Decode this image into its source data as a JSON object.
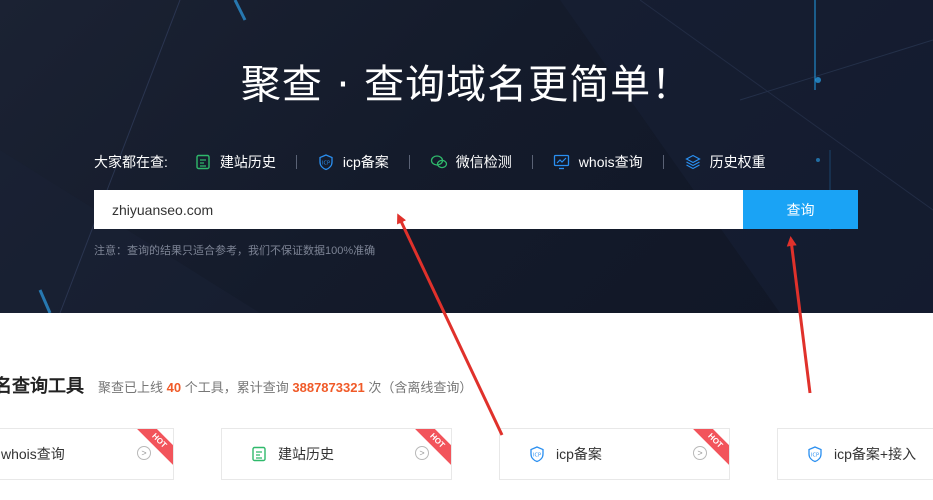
{
  "hero": {
    "title": "聚查 · 查询域名更简单！",
    "trending_label": "大家都在查:",
    "trending": [
      {
        "label": "建站历史",
        "icon": "history-icon",
        "color": "#2fb96b"
      },
      {
        "label": "icp备案",
        "icon": "icp-shield-icon",
        "color": "#2a8ff0"
      },
      {
        "label": "微信检测",
        "icon": "wechat-icon",
        "color": "#2fb96b"
      },
      {
        "label": "whois查询",
        "icon": "whois-monitor-icon",
        "color": "#2a8ff0"
      },
      {
        "label": "历史权重",
        "icon": "layers-icon",
        "color": "#2a8ff0"
      }
    ]
  },
  "search": {
    "value": "zhiyuanseo.com",
    "button_label": "查询",
    "notice": "注意：查询的结果只适合参考，我们不保证数据100%准确"
  },
  "section": {
    "title": "名查询工具",
    "stats_prefix": "聚查已上线",
    "tool_count": "40",
    "stats_mid": "个工具，累计查询",
    "query_count": "3887873321",
    "stats_suffix": "次（含离线查询）"
  },
  "cards": [
    {
      "label": "whois查询",
      "icon": "",
      "hot": "HOT"
    },
    {
      "label": "建站历史",
      "icon": "history-icon",
      "hot": "HOT"
    },
    {
      "label": "icp备案",
      "icon": "icp-shield-icon",
      "hot": "HOT"
    },
    {
      "label": "icp备案+接入",
      "icon": "icp-shield-icon",
      "hot": ""
    }
  ],
  "colors": {
    "accent": "#1aa3f5",
    "hero_bg": "#141b2b",
    "highlight": "#f05a28",
    "hot_badge": "#f2545b",
    "annotation": "#e0312b"
  }
}
